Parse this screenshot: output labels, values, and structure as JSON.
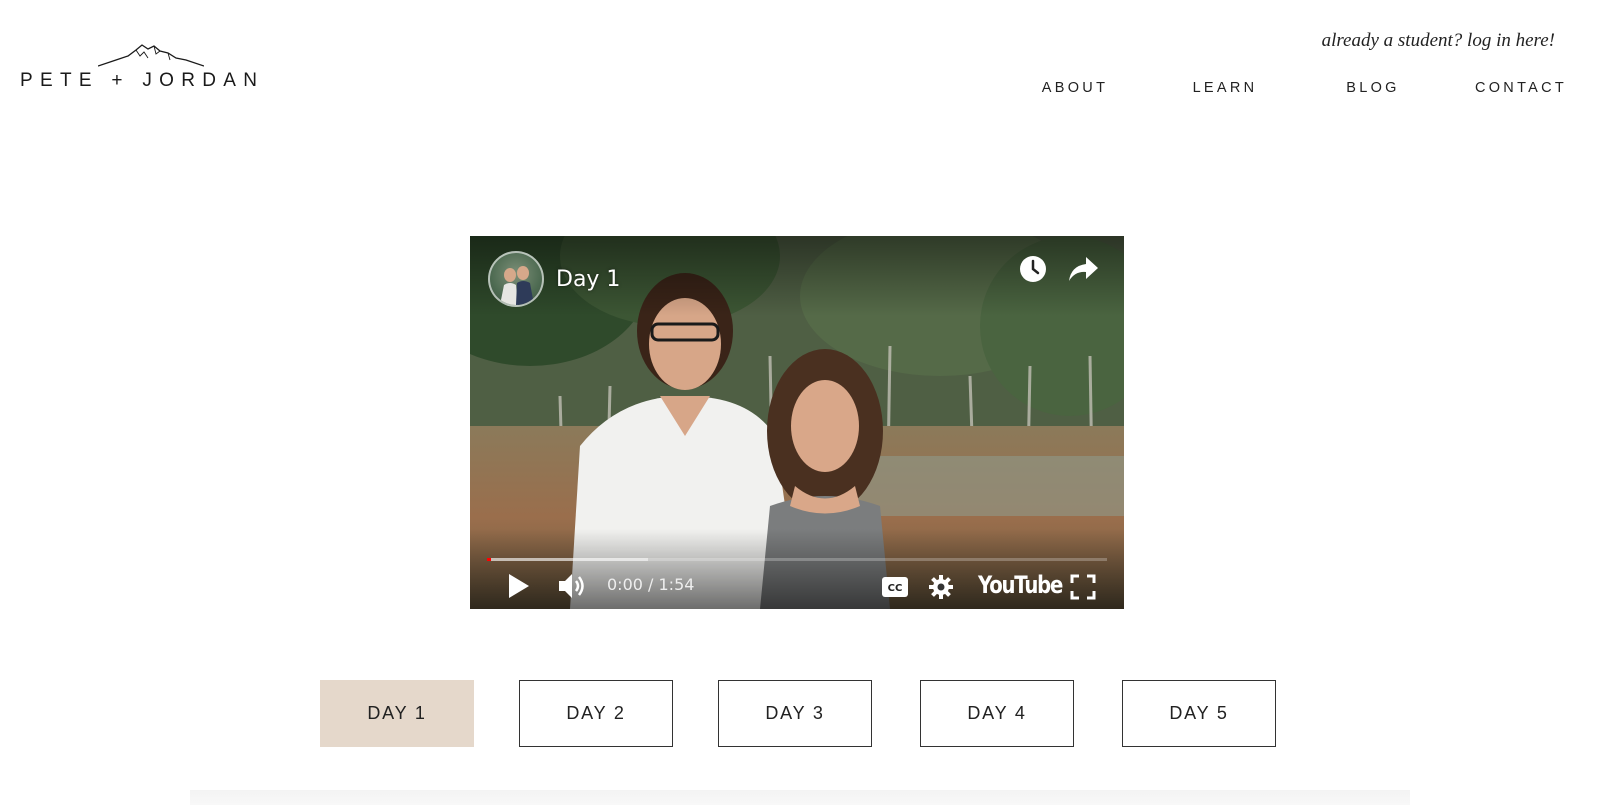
{
  "brand": {
    "logo_text": "PETE + JORDAN",
    "logo_icon": "mountain-icon"
  },
  "header": {
    "student_link": "already a student? log in here!"
  },
  "nav": {
    "items": [
      {
        "label": "ABOUT"
      },
      {
        "label": "LEARN"
      },
      {
        "label": "BLOG"
      },
      {
        "label": "CONTACT"
      }
    ]
  },
  "video": {
    "title": "Day 1",
    "current_time": "0:00",
    "duration": "1:54",
    "time_display": "0:00 / 1:54",
    "played_fraction": 0,
    "buffered_fraction": 0.26,
    "platform": "YouTube",
    "icons": [
      "channel-avatar",
      "watch-later-icon",
      "share-icon",
      "play-icon",
      "volume-icon",
      "captions-icon",
      "settings-icon",
      "youtube-logo",
      "fullscreen-icon"
    ]
  },
  "days": {
    "active_index": 0,
    "buttons": [
      {
        "label": "DAY 1"
      },
      {
        "label": "DAY 2"
      },
      {
        "label": "DAY 3"
      },
      {
        "label": "DAY 4"
      },
      {
        "label": "DAY 5"
      }
    ]
  },
  "colors": {
    "active_button_bg": "#e5d8cb",
    "text": "#222222",
    "progress_played": "#ff0000"
  }
}
